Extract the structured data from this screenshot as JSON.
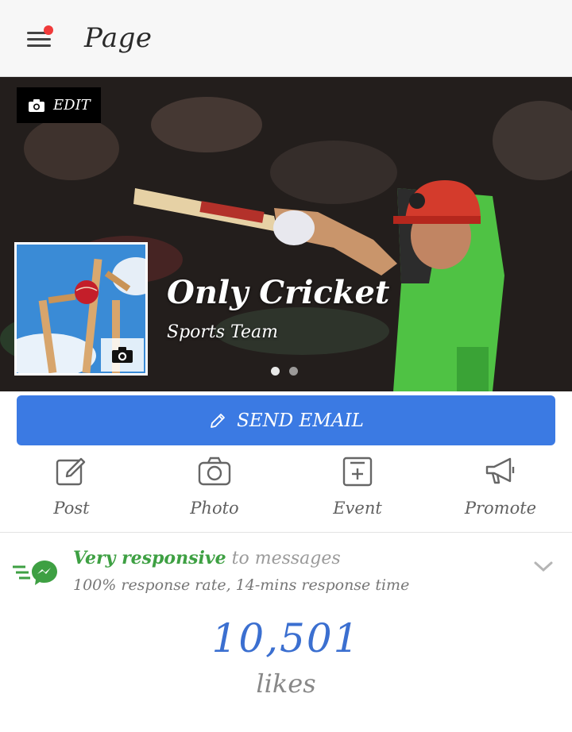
{
  "header": {
    "title": "Page"
  },
  "cover": {
    "edit_label": "EDIT",
    "name": "Only Cricket",
    "category": "Sports Team"
  },
  "send_email": {
    "label": "SEND EMAIL"
  },
  "actions": [
    {
      "label": "Post",
      "icon": "edit-icon"
    },
    {
      "label": "Photo",
      "icon": "camera-icon"
    },
    {
      "label": "Event",
      "icon": "calendar-plus-icon"
    },
    {
      "label": "Promote",
      "icon": "megaphone-icon"
    }
  ],
  "responsiveness": {
    "strong": "Very responsive",
    "weak": " to messages",
    "detail": "100% response rate, 14-mins response time"
  },
  "likes": {
    "count": "10,501",
    "label": "likes"
  },
  "colors": {
    "accent": "#3b7ae3",
    "responsive": "#3ea043",
    "likes": "#3b6fd0",
    "notification": "#f03a3a"
  }
}
